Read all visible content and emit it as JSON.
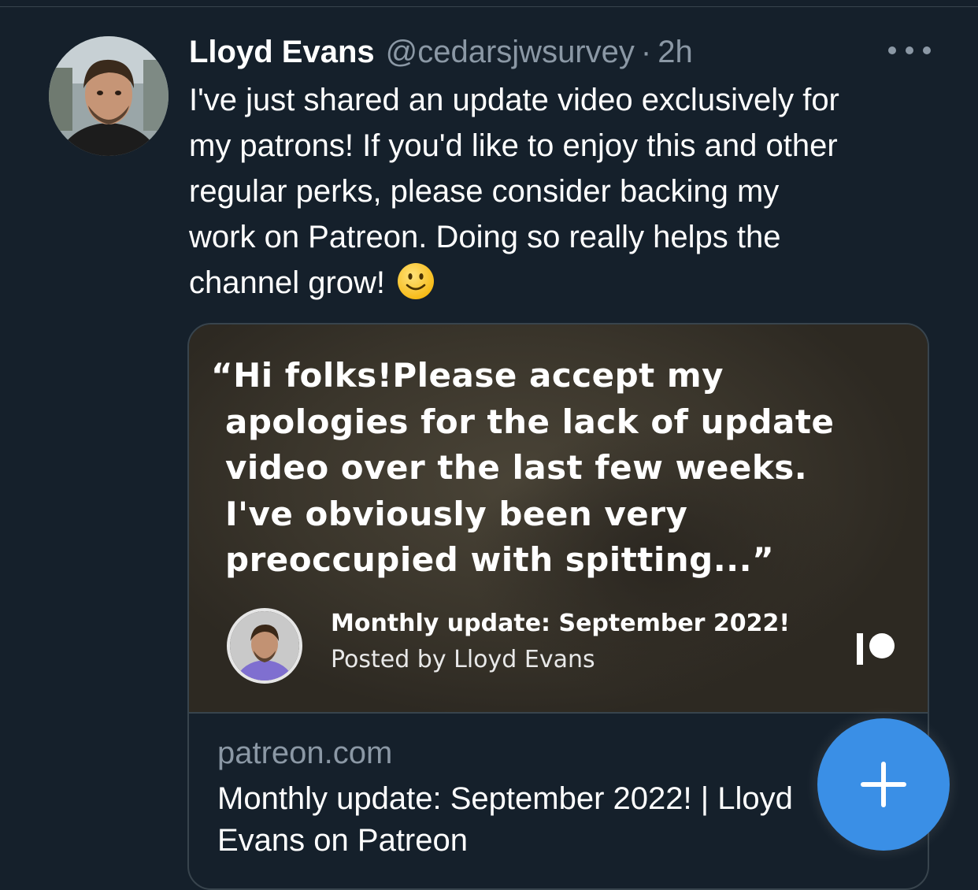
{
  "tweet": {
    "display_name": "Lloyd Evans",
    "handle": "@cedarsjwsurvey",
    "separator": "·",
    "time": "2h",
    "text_lines": [
      "I've just shared an update video exclusively for",
      "my patrons! If you'd like to enjoy this and other",
      "regular perks, please consider backing my",
      "work on Patreon. Doing so really helps the",
      "channel grow!"
    ],
    "emoji": "slightly-smiling-face-emoji"
  },
  "card": {
    "quote_lines": [
      "“Hi folks!Please accept my",
      "apologies for the lack of update",
      "video over the last few weeks.",
      "I've obviously been very",
      "preoccupied with spitting...”"
    ],
    "post_title": "Monthly update: September 2022!",
    "post_byline": "Posted by Lloyd Evans",
    "domain": "patreon.com",
    "title_lines": [
      "Monthly update: September 2022! | Lloyd",
      "Evans on Patreon"
    ]
  },
  "icons": {
    "more": "more-icon",
    "patreon": "patreon-logo-icon",
    "compose": "plus-icon"
  },
  "colors": {
    "background": "#15202b",
    "secondary_text": "#8b98a5",
    "border": "#38444d",
    "fab": "#3a8fe6"
  }
}
